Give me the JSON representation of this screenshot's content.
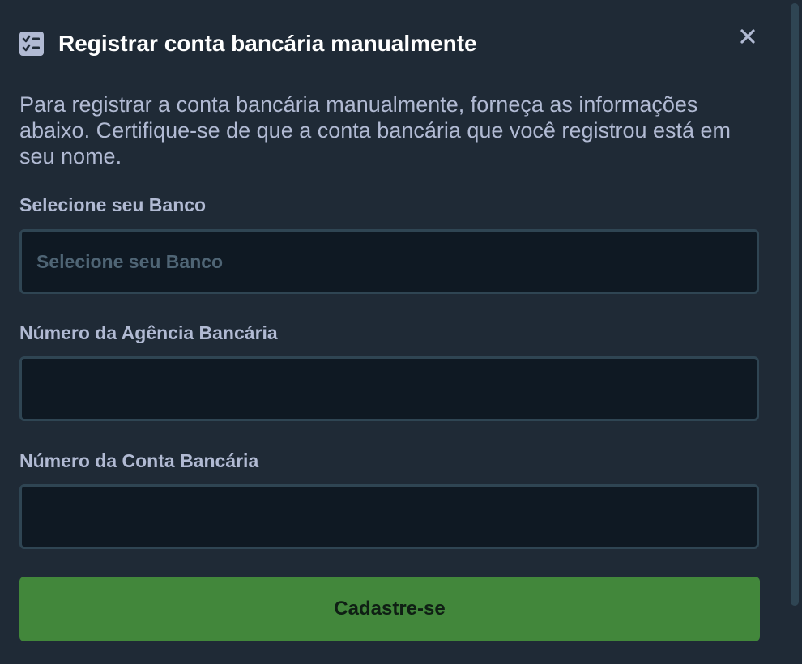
{
  "modal": {
    "title": "Registrar conta bancária manualmente",
    "header_icon": "checklist-icon",
    "close_icon": "close-icon",
    "description": "Para registrar a conta bancária manualmente, forneça as informações abaixo. Certifique-se de que a conta bancária que você registrou está em seu nome."
  },
  "form": {
    "bank": {
      "label": "Selecione seu Banco",
      "placeholder": "Selecione seu Banco",
      "value": ""
    },
    "agency": {
      "label": "Número da Agência Bancária",
      "placeholder": "",
      "value": ""
    },
    "account": {
      "label": "Número da Conta Bancária",
      "placeholder": "",
      "value": ""
    },
    "submit_label": "Cadastre-se"
  },
  "colors": {
    "background": "#1f2a36",
    "input_background": "#0f1923",
    "input_border": "#2f4553",
    "label_text": "#b1bad3",
    "title_text": "#ffffff",
    "placeholder_text": "#4f6575",
    "submit_background": "#42873b",
    "submit_text": "#0f1f14"
  }
}
